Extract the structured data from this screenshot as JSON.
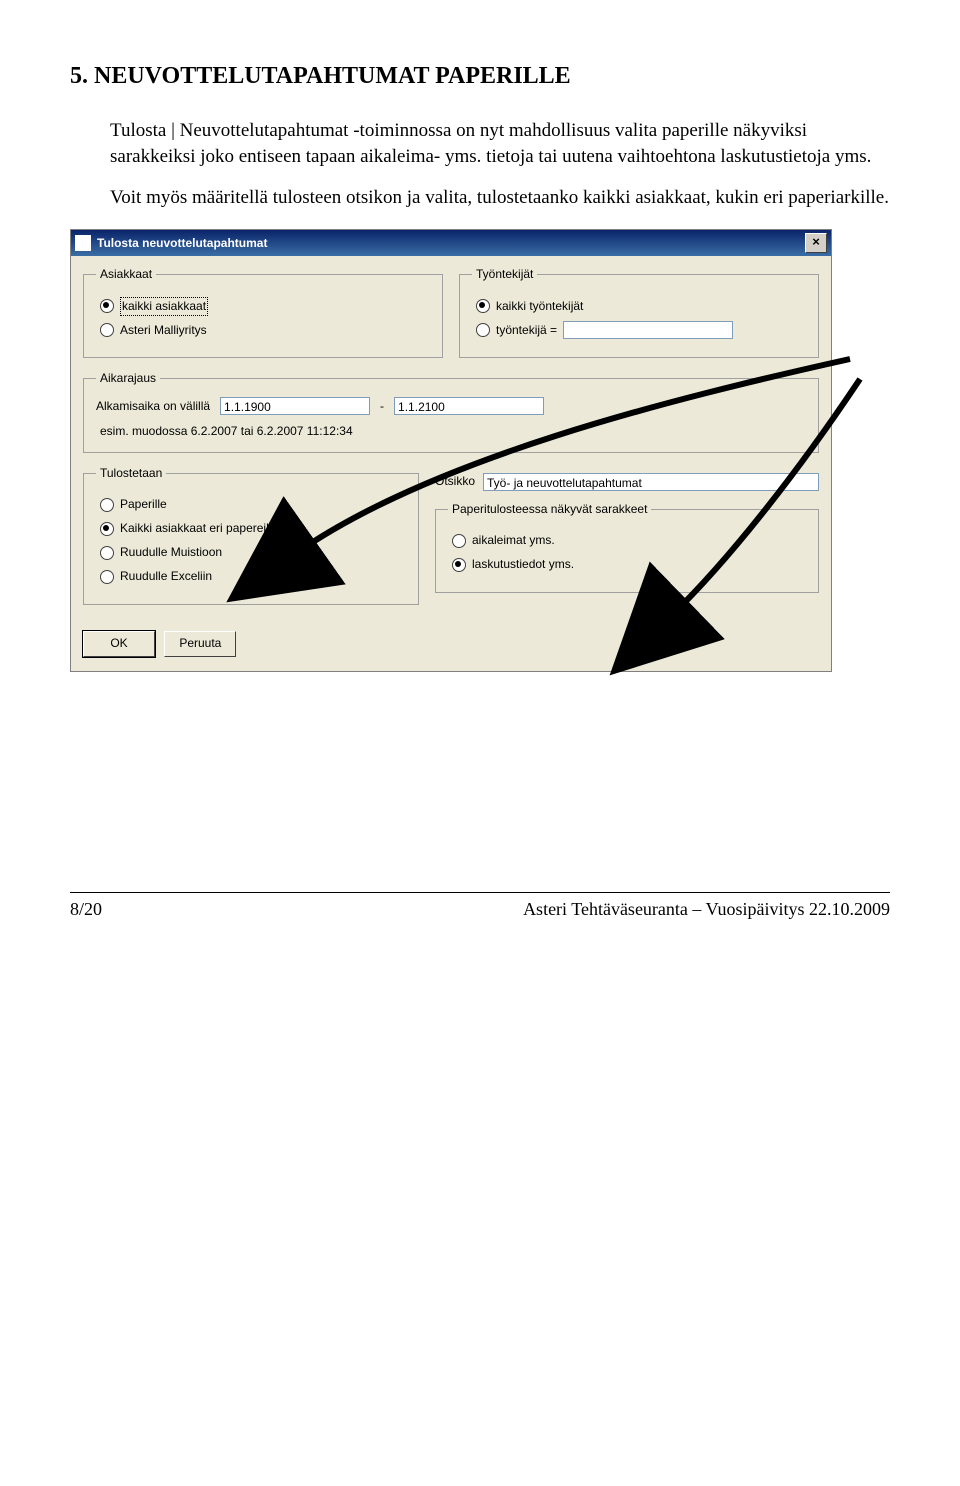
{
  "page": {
    "heading": "5.    NEUVOTTELUTAPAHTUMAT PAPERILLE",
    "para1": "Tulosta | Neuvottelutapahtumat -toiminnossa on nyt mahdollisuus valita paperille näkyviksi sarakkeiksi joko entiseen tapaan aikaleima- yms. tietoja tai uutena vaihtoehtona laskutustietoja yms.",
    "para2": "Voit myös määritellä tulosteen otsikon ja valita, tulostetaanko kaikki asiakkaat, kukin eri paperiarkille.",
    "footer_left": "8/20",
    "footer_right": "Asteri Tehtäväseuranta – Vuosipäivitys 22.10.2009"
  },
  "dialog": {
    "title": "Tulosta neuvottelutapahtumat",
    "close_glyph": "×",
    "asiakkaat": {
      "legend": "Asiakkaat",
      "opt_all": "kaikki asiakkaat",
      "opt_one": "Asteri Malliyritys"
    },
    "tyontekijat": {
      "legend": "Työntekijät",
      "opt_all": "kaikki työntekijät",
      "opt_one": "työntekijä =",
      "value": ""
    },
    "aika": {
      "legend": "Aikarajaus",
      "label": "Alkamisaika on välillä",
      "from": "1.1.1900",
      "dash": "-",
      "to": "1.1.2100",
      "hint": "esim. muodossa 6.2.2007 tai 6.2.2007 11:12:34"
    },
    "tulostetaan": {
      "legend": "Tulostetaan",
      "opt_paper": "Paperille",
      "opt_all_sep": "Kaikki asiakkaat eri papereille",
      "opt_muistio": "Ruudulle Muistioon",
      "opt_excel": "Ruudulle Exceliin"
    },
    "otsikko": {
      "label": "Otsikko",
      "value": "Työ- ja neuvottelutapahtumat"
    },
    "sarakkeet": {
      "legend": "Paperitulosteessa näkyvät sarakkeet",
      "opt_aika": "aikaleimat yms.",
      "opt_lasku": "laskutustiedot yms."
    },
    "buttons": {
      "ok": "OK",
      "cancel": "Peruuta"
    }
  }
}
